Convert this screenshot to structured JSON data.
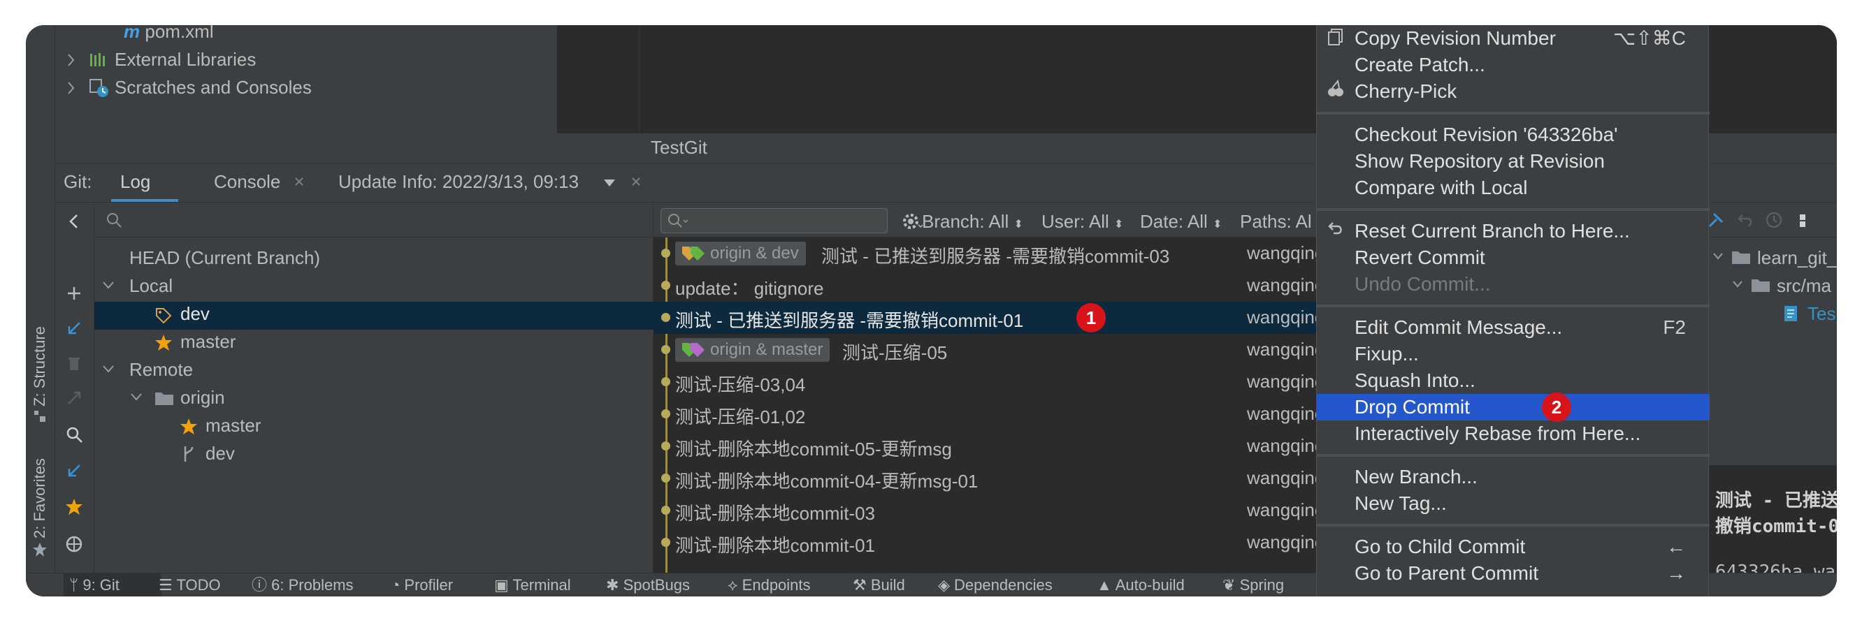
{
  "project_tree": {
    "pom": "pom.xml",
    "external_libraries": "External Libraries",
    "scratches": "Scratches and Consoles"
  },
  "editor": {
    "tab_title": "TestGit"
  },
  "git_toolwindow": {
    "prefix": "Git:",
    "tabs": [
      {
        "label": "Log",
        "active": true
      },
      {
        "label": "Console",
        "closable": true
      },
      {
        "label": "Update Info: 2022/3/13, 09:13",
        "closable": true,
        "dropdown": true
      }
    ]
  },
  "branches": {
    "head": "HEAD (Current Branch)",
    "local_label": "Local",
    "local": [
      {
        "name": "dev",
        "icon": "tag-icon",
        "selected": true
      },
      {
        "name": "master",
        "icon": "star-icon"
      }
    ],
    "remote_label": "Remote",
    "origin_label": "origin",
    "remote": [
      {
        "name": "master",
        "icon": "star-icon"
      },
      {
        "name": "dev",
        "icon": "branch-icon"
      }
    ]
  },
  "log_toolbar": {
    "filters": [
      "Branch: All",
      "User: All",
      "Date: All",
      "Paths: Al"
    ]
  },
  "commits": [
    {
      "tag": "origin & dev",
      "message": "测试 - 已推送到服务器 -需要撤销commit-03",
      "author": "wangqingli"
    },
    {
      "tag": "",
      "message": "update： gitignore",
      "author": "wangqingli"
    },
    {
      "tag": "",
      "message": "测试 - 已推送到服务器 -需要撤销commit-01",
      "author": "wangqingli",
      "selected": true,
      "badge": "1"
    },
    {
      "tag": "origin & master",
      "message": "测试-压缩-05",
      "author": "wangqingli"
    },
    {
      "tag": "",
      "message": "测试-压缩-03,04",
      "author": "wangqingli"
    },
    {
      "tag": "",
      "message": "测试-压缩-01,02",
      "author": "wangqingli"
    },
    {
      "tag": "",
      "message": "测试-删除本地commit-05-更新msg",
      "author": "wangqingli"
    },
    {
      "tag": "",
      "message": "测试-删除本地commit-04-更新msg-01",
      "author": "wangqingli"
    },
    {
      "tag": "",
      "message": "测试-删除本地commit-03",
      "author": "wangqingli"
    },
    {
      "tag": "",
      "message": "测试-删除本地commit-01",
      "author": "wangqingli"
    }
  ],
  "details": {
    "tree_root": "learn_git_",
    "tree_child": "src/ma",
    "tree_file": "Tes",
    "message_line1": "测试 - 已推送",
    "message_line2": "撤销commit-0",
    "hash": "643326ba wa"
  },
  "left_stripe": {
    "structure": "Z: Structure",
    "favorites": "2: Favorites"
  },
  "bottom_bar": [
    {
      "label": "9: Git",
      "icon": "git-branch-icon",
      "active": true
    },
    {
      "label": "TODO",
      "icon": "list-icon"
    },
    {
      "label": "6: Problems",
      "icon": "info-icon"
    },
    {
      "label": "Profiler",
      "icon": "profiler-icon"
    },
    {
      "label": "Terminal",
      "icon": "terminal-icon"
    },
    {
      "label": "SpotBugs",
      "icon": "bug-icon"
    },
    {
      "label": "Endpoints",
      "icon": "endpoints-icon"
    },
    {
      "label": "Build",
      "icon": "hammer-icon"
    },
    {
      "label": "Dependencies",
      "icon": "dependencies-icon"
    },
    {
      "label": "Auto-build",
      "icon": "warning-icon"
    },
    {
      "label": "Spring",
      "icon": "leaf-icon"
    }
  ],
  "context_menu": {
    "groups": [
      [
        {
          "label": "Copy Revision Number",
          "shortcut": "⌥⇧⌘C"
        },
        {
          "label": "Create Patch..."
        },
        {
          "label": "Cherry-Pick"
        }
      ],
      [
        {
          "label": "Checkout Revision '643326ba'"
        },
        {
          "label": "Show Repository at Revision"
        },
        {
          "label": "Compare with Local"
        }
      ],
      [
        {
          "label": "Reset Current Branch to Here..."
        },
        {
          "label": "Revert Commit"
        },
        {
          "label": "Undo Commit...",
          "disabled": true
        }
      ],
      [
        {
          "label": "Edit Commit Message...",
          "shortcut": "F2"
        },
        {
          "label": "Fixup..."
        },
        {
          "label": "Squash Into..."
        },
        {
          "label": "Drop Commit",
          "selected": true,
          "badge": "2"
        },
        {
          "label": "Interactively Rebase from Here..."
        }
      ],
      [
        {
          "label": "New Branch..."
        },
        {
          "label": "New Tag..."
        }
      ],
      [
        {
          "label": "Go to Child Commit",
          "shortcut": "←"
        },
        {
          "label": "Go to Parent Commit",
          "shortcut": "→"
        }
      ]
    ]
  },
  "colors": {
    "selection": "#2457cc",
    "selected_row": "#0d293e",
    "badge": "#d8141b",
    "graph": "#b7aa5a"
  }
}
